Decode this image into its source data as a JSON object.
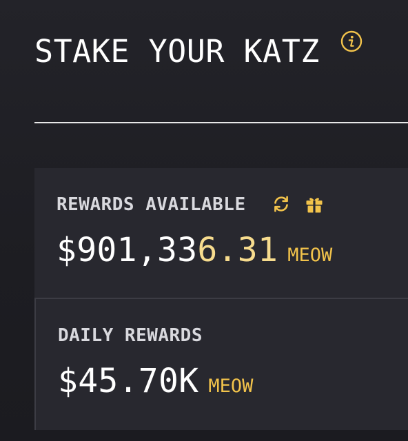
{
  "header": {
    "title": "STAKE YOUR KATZ",
    "info_icon": "info-icon"
  },
  "rewards_available": {
    "label": "REWARDS AVAILABLE",
    "amount_main": "$901,33",
    "amount_highlight": "6.31",
    "unit": "MEOW",
    "icons": [
      "refresh-icon",
      "gift-icon"
    ]
  },
  "daily_rewards": {
    "label": "DAILY REWARDS",
    "amount": "$45.70K",
    "unit": "MEOW"
  },
  "colors": {
    "background": "#202026",
    "panel": "#28282f",
    "accent": "#f2c34b",
    "accent_light": "#f7dc8e",
    "text": "#ffffff",
    "label": "#d9d9de"
  }
}
